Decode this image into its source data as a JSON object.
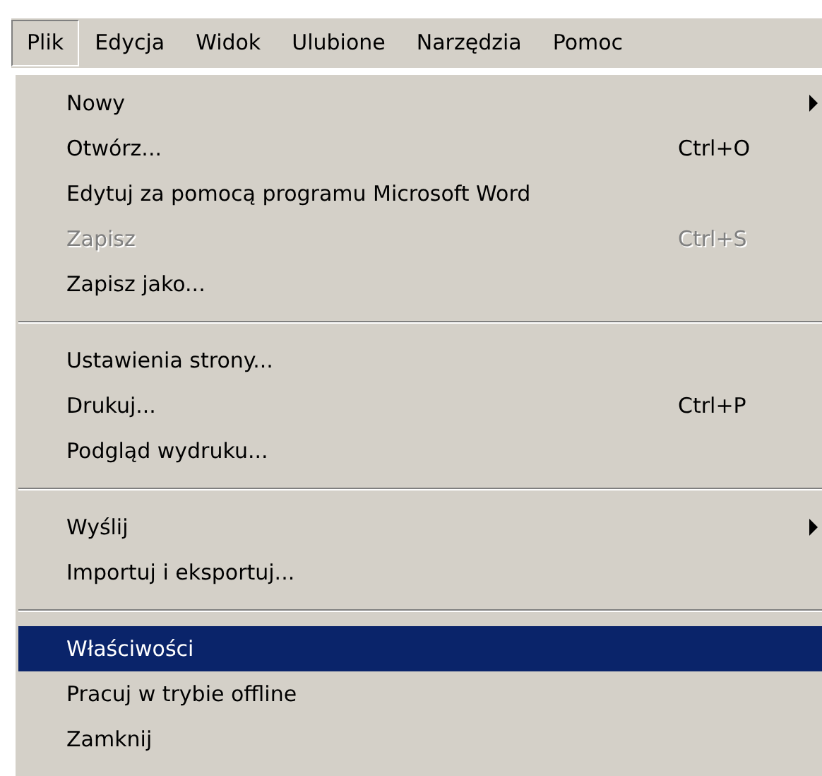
{
  "menubar": [
    {
      "label": "Plik",
      "selected": true
    },
    {
      "label": "Edycja",
      "selected": false
    },
    {
      "label": "Widok",
      "selected": false
    },
    {
      "label": "Ulubione",
      "selected": false
    },
    {
      "label": "Narzędzia",
      "selected": false
    },
    {
      "label": "Pomoc",
      "selected": false
    }
  ],
  "menu": [
    {
      "kind": "item",
      "label": "Nowy",
      "submenu": true,
      "disabled": false,
      "selected": false
    },
    {
      "kind": "item",
      "label": "Otwórz...",
      "shortcut": "Ctrl+O",
      "disabled": false,
      "selected": false
    },
    {
      "kind": "item",
      "label": "Edytuj za pomocą programu Microsoft Word",
      "disabled": false,
      "selected": false
    },
    {
      "kind": "item",
      "label": "Zapisz",
      "shortcut": "Ctrl+S",
      "disabled": true,
      "selected": false
    },
    {
      "kind": "item",
      "label": "Zapisz jako...",
      "disabled": false,
      "selected": false
    },
    {
      "kind": "separator"
    },
    {
      "kind": "item",
      "label": "Ustawienia strony...",
      "disabled": false,
      "selected": false
    },
    {
      "kind": "item",
      "label": "Drukuj...",
      "shortcut": "Ctrl+P",
      "disabled": false,
      "selected": false
    },
    {
      "kind": "item",
      "label": "Podgląd wydruku...",
      "disabled": false,
      "selected": false
    },
    {
      "kind": "separator"
    },
    {
      "kind": "item",
      "label": "Wyślij",
      "submenu": true,
      "disabled": false,
      "selected": false
    },
    {
      "kind": "item",
      "label": "Importuj i eksportuj...",
      "disabled": false,
      "selected": false
    },
    {
      "kind": "separator"
    },
    {
      "kind": "item",
      "label": "Właściwości",
      "disabled": false,
      "selected": true
    },
    {
      "kind": "item",
      "label": "Pracuj w trybie offline",
      "disabled": false,
      "selected": false
    },
    {
      "kind": "item",
      "label": "Zamknij",
      "disabled": false,
      "selected": false
    }
  ]
}
